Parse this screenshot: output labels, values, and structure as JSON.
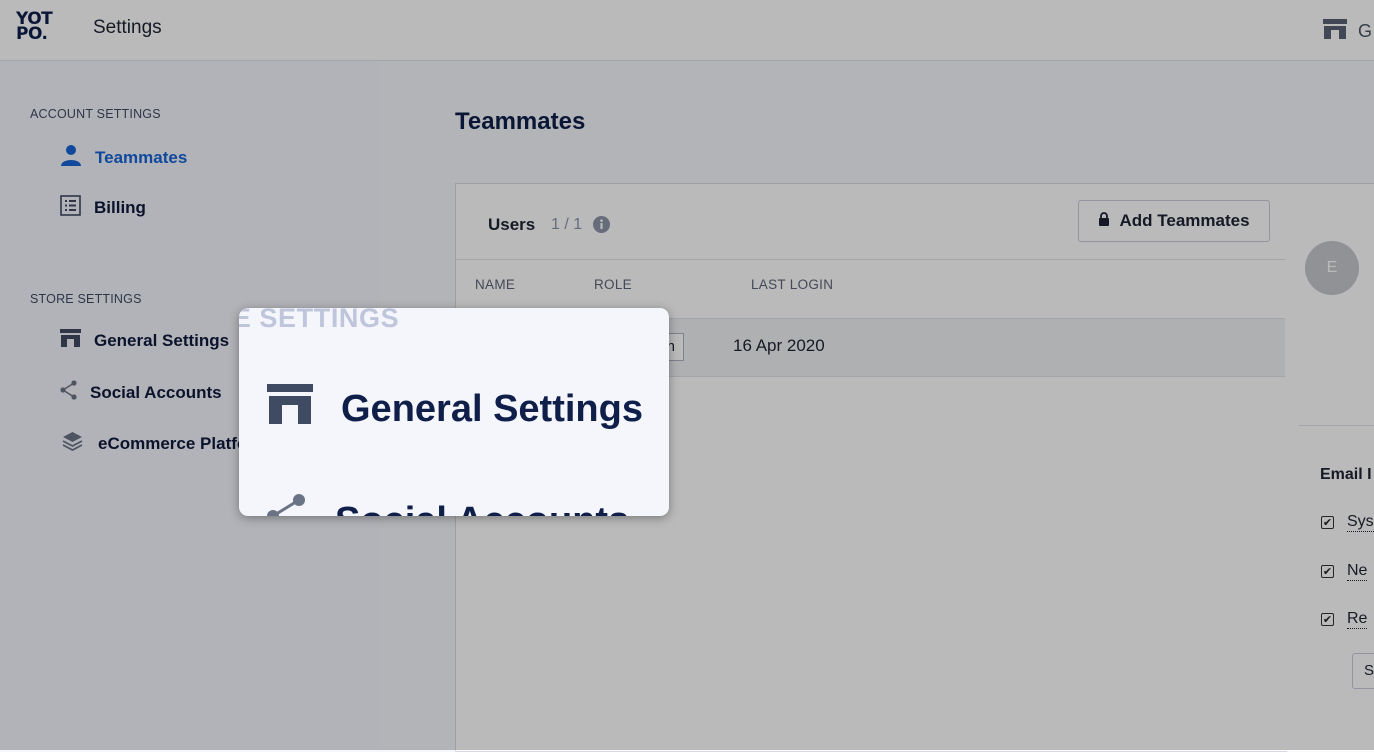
{
  "header": {
    "logo_line1": "YOT",
    "logo_line2": "PO.",
    "title": "Settings",
    "store_label": "G"
  },
  "sidebar": {
    "account_section": "ACCOUNT SETTINGS",
    "account_items": [
      {
        "label": "Teammates",
        "icon": "person-icon",
        "active": true
      },
      {
        "label": "Billing",
        "icon": "list-icon",
        "active": false
      }
    ],
    "store_section": "STORE SETTINGS",
    "store_items": [
      {
        "label": "General Settings",
        "icon": "store-icon"
      },
      {
        "label": "Social Accounts",
        "icon": "share-icon"
      },
      {
        "label": "eCommerce Platfo",
        "icon": "layers-icon"
      }
    ]
  },
  "main": {
    "title": "Teammates",
    "users_label": "Users",
    "users_count": "1 / 1",
    "add_button": "Add Teammates",
    "columns": [
      "NAME",
      "ROLE",
      "LAST LOGIN"
    ],
    "rows": [
      {
        "role": "n",
        "last_login": "16 Apr 2020"
      }
    ]
  },
  "right_panel": {
    "avatar_initial": "E",
    "email_title": "Email I",
    "checkboxes": [
      {
        "label": "Sys",
        "checked": true
      },
      {
        "label": "Ne",
        "checked": true
      },
      {
        "label": "Re",
        "checked": true
      }
    ],
    "select_value": "Se"
  },
  "zoom": {
    "section": "ORE SETTINGS",
    "item1": "General Settings",
    "item2": "Social Accounts"
  },
  "colors": {
    "accent": "#1763d6",
    "navy": "#0f1f4a",
    "overlay": "rgba(0,0,0,0.27)"
  }
}
